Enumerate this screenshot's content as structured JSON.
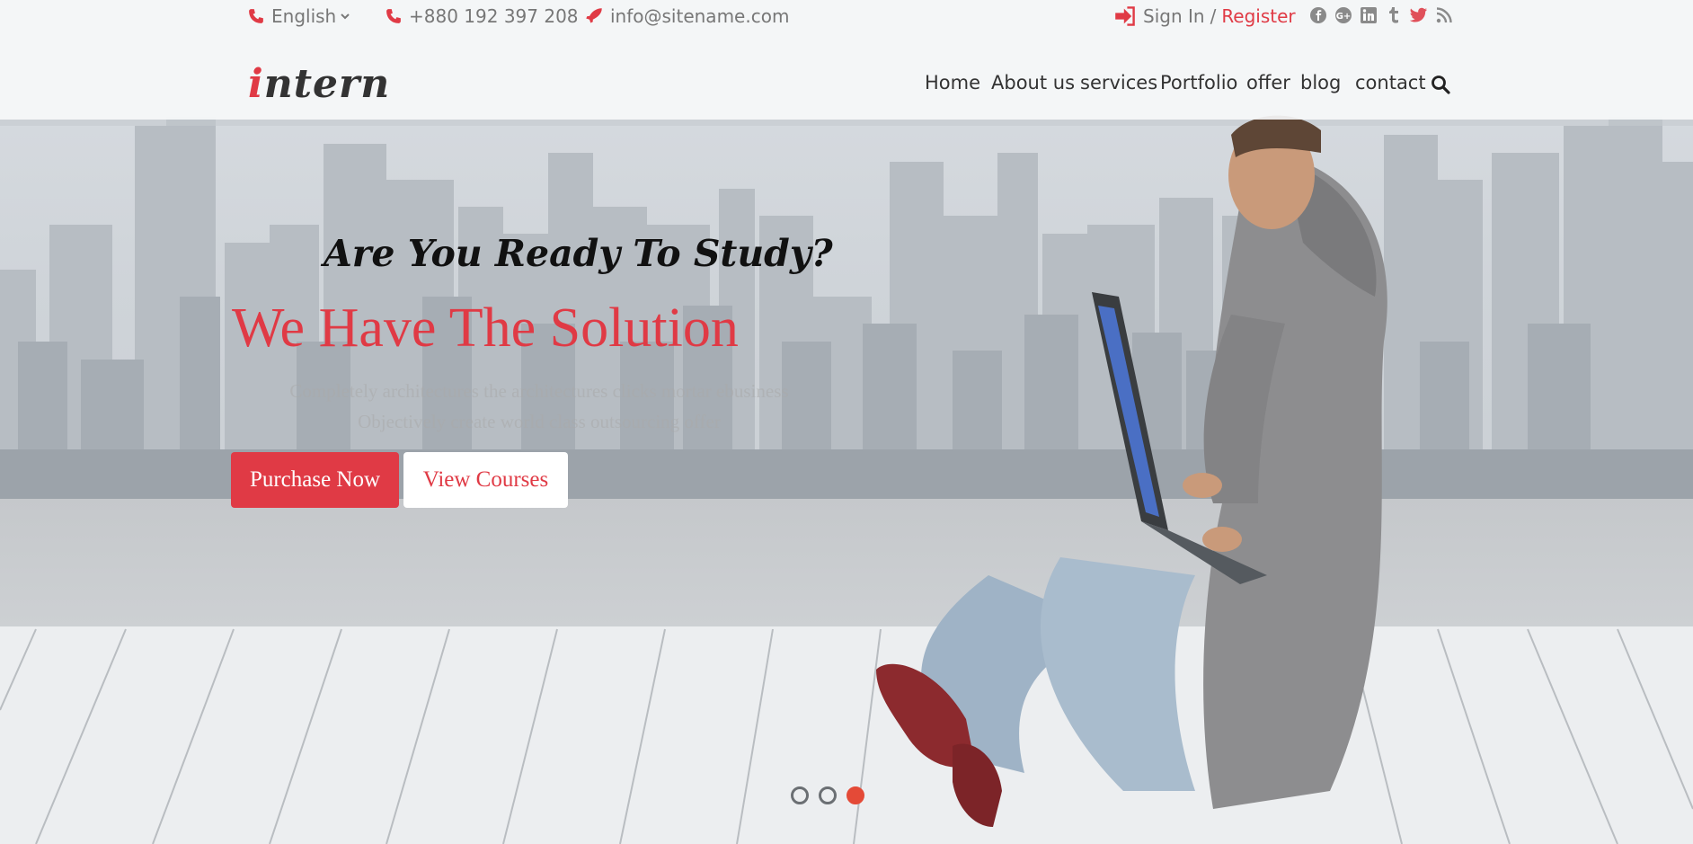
{
  "topbar": {
    "language": "English",
    "phone": "+880 192 397 208",
    "email": "info@sitename.com",
    "sign_in": "Sign In",
    "separator": "/",
    "register": "Register",
    "social_icons": [
      "facebook-icon",
      "google-plus-icon",
      "linkedin-icon",
      "tumblr-icon",
      "twitter-icon",
      "rss-icon"
    ]
  },
  "logo": {
    "first": "i",
    "rest": "ntern"
  },
  "nav": {
    "items": [
      "Home",
      "About us",
      "services",
      "Portfolio",
      "offer",
      "blog",
      "contact"
    ]
  },
  "hero": {
    "kicker": "Are You Ready To Study?",
    "headline": "We Have The Solution",
    "desc_line1": "Completely architectures the architectures clicks mortar ebusiness",
    "desc_line2": "Objectively create world class outsourcing offer",
    "primary_button": "Purchase Now",
    "secondary_button": "View Courses"
  },
  "slider": {
    "count": 3,
    "active": 3
  },
  "colors": {
    "accent": "#e03a45",
    "text": "#333333",
    "muted": "#777777",
    "twitter": "#e0505a"
  }
}
